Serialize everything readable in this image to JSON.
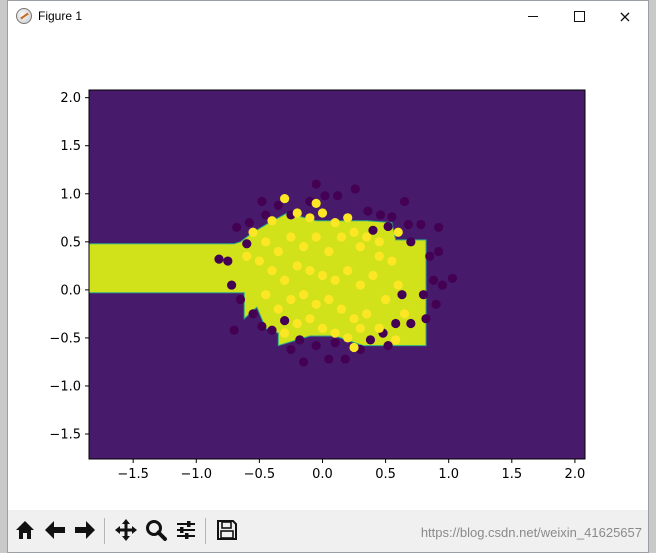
{
  "window": {
    "title": "Figure 1"
  },
  "window_controls": {
    "minimize": "",
    "maximize": "",
    "close": "×"
  },
  "toolbar": {
    "buttons": [
      "home-icon",
      "back-icon",
      "forward-icon",
      "pan-icon",
      "zoom-icon",
      "configure-icon",
      "save-icon"
    ]
  },
  "watermark": "https://blog.csdn.net/weixin_41625657",
  "colors": {
    "background_region": "#481a6c",
    "decision_region": "#d1e21b",
    "class0": "#440154",
    "class1": "#fde725"
  },
  "chart_data": {
    "type": "scatter",
    "title": "",
    "xlabel": "",
    "ylabel": "",
    "xlim": [
      -1.85,
      2.08
    ],
    "ylim": [
      -1.76,
      2.08
    ],
    "xticks": [
      "−1.5",
      "−1.0",
      "−0.5",
      "0.0",
      "0.5",
      "1.0",
      "1.5",
      "2.0"
    ],
    "xtick_values": [
      -1.5,
      -1.0,
      -0.5,
      0.0,
      0.5,
      1.0,
      1.5,
      2.0
    ],
    "yticks": [
      "2.0",
      "1.5",
      "1.0",
      "0.5",
      "0.0",
      "−0.5",
      "−1.0",
      "−1.5"
    ],
    "ytick_values": [
      2.0,
      1.5,
      1.0,
      0.5,
      0.0,
      -0.5,
      -1.0,
      -1.5
    ],
    "decision_region": [
      [
        -1.85,
        0.48
      ],
      [
        -0.7,
        0.48
      ],
      [
        -0.65,
        0.5
      ],
      [
        -0.55,
        0.6
      ],
      [
        -0.42,
        0.7
      ],
      [
        -0.28,
        0.8
      ],
      [
        -0.05,
        0.72
      ],
      [
        0.35,
        0.72
      ],
      [
        0.55,
        0.7
      ],
      [
        0.58,
        0.52
      ],
      [
        0.82,
        0.52
      ],
      [
        0.82,
        -0.58
      ],
      [
        0.32,
        -0.58
      ],
      [
        0.1,
        -0.48
      ],
      [
        -0.1,
        -0.48
      ],
      [
        -0.35,
        -0.58
      ],
      [
        -0.35,
        -0.45
      ],
      [
        -0.45,
        -0.4
      ],
      [
        -0.52,
        -0.18
      ],
      [
        -0.62,
        -0.3
      ],
      [
        -0.62,
        -0.03
      ],
      [
        -1.85,
        -0.03
      ]
    ],
    "series": [
      {
        "class": 0,
        "points": [
          [
            -0.82,
            0.32
          ],
          [
            -0.75,
            0.3
          ],
          [
            -0.72,
            0.05
          ],
          [
            -0.68,
            0.65
          ],
          [
            -0.6,
            0.48
          ],
          [
            -0.58,
            0.7
          ],
          [
            -0.45,
            0.78
          ],
          [
            -0.48,
            0.92
          ],
          [
            -0.35,
            0.88
          ],
          [
            -0.25,
            0.78
          ],
          [
            -0.1,
            0.92
          ],
          [
            -0.05,
            1.1
          ],
          [
            0.02,
            0.98
          ],
          [
            0.12,
            0.98
          ],
          [
            0.26,
            1.05
          ],
          [
            0.36,
            0.82
          ],
          [
            0.46,
            0.78
          ],
          [
            0.55,
            0.76
          ],
          [
            0.65,
            0.92
          ],
          [
            0.68,
            0.68
          ],
          [
            0.78,
            0.68
          ],
          [
            0.92,
            0.65
          ],
          [
            0.92,
            0.4
          ],
          [
            0.85,
            0.35
          ],
          [
            0.88,
            0.1
          ],
          [
            0.95,
            0.05
          ],
          [
            1.03,
            0.12
          ],
          [
            0.9,
            -0.15
          ],
          [
            0.82,
            -0.3
          ],
          [
            0.7,
            -0.35
          ],
          [
            0.58,
            -0.35
          ],
          [
            0.52,
            -0.58
          ],
          [
            0.38,
            -0.52
          ],
          [
            0.3,
            -0.62
          ],
          [
            0.18,
            -0.72
          ],
          [
            0.1,
            -0.55
          ],
          [
            -0.05,
            -0.58
          ],
          [
            -0.18,
            -0.52
          ],
          [
            -0.25,
            -0.62
          ],
          [
            -0.4,
            -0.42
          ],
          [
            -0.48,
            -0.38
          ],
          [
            -0.65,
            -0.1
          ],
          [
            -0.7,
            -0.42
          ],
          [
            -0.55,
            -0.25
          ],
          [
            -0.3,
            -0.32
          ],
          [
            0.52,
            0.66
          ],
          [
            0.48,
            -0.45
          ],
          [
            -0.15,
            -0.75
          ],
          [
            0.05,
            -0.72
          ],
          [
            0.7,
            0.5
          ],
          [
            0.8,
            -0.05
          ],
          [
            0.63,
            -0.05
          ],
          [
            0.4,
            0.62
          ]
        ]
      },
      {
        "class": 1,
        "points": [
          [
            -0.3,
            0.95
          ],
          [
            -0.2,
            0.8
          ],
          [
            -0.1,
            0.75
          ],
          [
            0.0,
            0.8
          ],
          [
            0.1,
            0.7
          ],
          [
            -0.4,
            0.72
          ],
          [
            -0.55,
            0.6
          ],
          [
            -0.6,
            0.35
          ],
          [
            -0.5,
            0.3
          ],
          [
            -0.45,
            0.5
          ],
          [
            -0.35,
            0.4
          ],
          [
            -0.25,
            0.55
          ],
          [
            -0.15,
            0.45
          ],
          [
            -0.05,
            0.55
          ],
          [
            0.05,
            0.4
          ],
          [
            0.15,
            0.55
          ],
          [
            0.25,
            0.6
          ],
          [
            0.35,
            0.55
          ],
          [
            0.45,
            0.5
          ],
          [
            0.3,
            0.45
          ],
          [
            -0.4,
            0.2
          ],
          [
            -0.3,
            0.1
          ],
          [
            -0.2,
            0.25
          ],
          [
            -0.1,
            0.2
          ],
          [
            0.0,
            0.15
          ],
          [
            0.1,
            0.1
          ],
          [
            0.2,
            0.2
          ],
          [
            0.3,
            0.05
          ],
          [
            0.4,
            0.15
          ],
          [
            -0.45,
            -0.05
          ],
          [
            -0.35,
            -0.2
          ],
          [
            -0.25,
            -0.1
          ],
          [
            -0.15,
            -0.05
          ],
          [
            -0.05,
            -0.15
          ],
          [
            0.05,
            -0.1
          ],
          [
            0.15,
            -0.2
          ],
          [
            0.25,
            -0.3
          ],
          [
            0.35,
            -0.25
          ],
          [
            0.45,
            -0.4
          ],
          [
            0.5,
            -0.1
          ],
          [
            0.55,
            0.3
          ],
          [
            0.6,
            0.05
          ],
          [
            -0.2,
            -0.35
          ],
          [
            -0.1,
            -0.3
          ],
          [
            0.0,
            -0.4
          ],
          [
            0.1,
            -0.45
          ],
          [
            0.2,
            -0.5
          ],
          [
            0.3,
            -0.4
          ],
          [
            -0.3,
            -0.45
          ],
          [
            0.6,
            0.6
          ],
          [
            0.65,
            -0.25
          ],
          [
            -0.05,
            0.9
          ],
          [
            0.2,
            0.75
          ],
          [
            0.45,
            0.35
          ],
          [
            0.25,
            -0.6
          ],
          [
            0.58,
            -0.52
          ]
        ]
      }
    ]
  }
}
